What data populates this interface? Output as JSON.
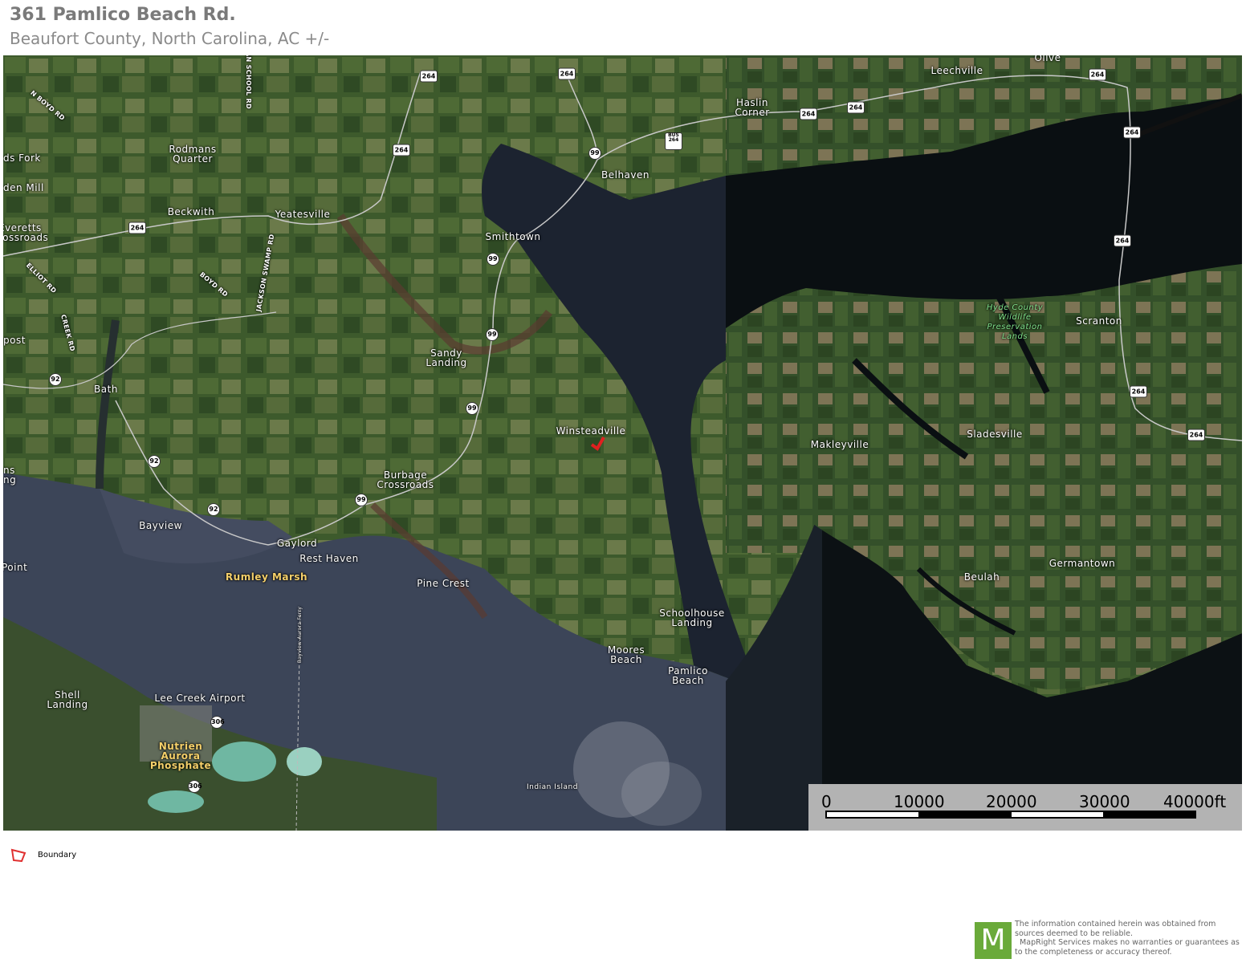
{
  "header": {
    "title": "361 Pamlico Beach Rd.",
    "subtitle": "Beaufort County, North Carolina,  AC +/-"
  },
  "map": {
    "places": [
      {
        "name": "Olive",
        "type": "town"
      },
      {
        "name": "Leechville",
        "type": "town"
      },
      {
        "name": "Haslin Corner",
        "type": "town"
      },
      {
        "name": "Belhaven",
        "type": "town"
      },
      {
        "name": "Rodmans Quarter",
        "type": "town"
      },
      {
        "name": "Beckwith",
        "type": "town"
      },
      {
        "name": "Yeatesville",
        "type": "town"
      },
      {
        "name": "Smithtown",
        "type": "town"
      },
      {
        "name": "Sandy Landing",
        "type": "town"
      },
      {
        "name": "Bath",
        "type": "town"
      },
      {
        "name": "Winsteadville",
        "type": "town"
      },
      {
        "name": "Burbage Crossroads",
        "type": "town"
      },
      {
        "name": "Bayview",
        "type": "town"
      },
      {
        "name": "Gaylord",
        "type": "town"
      },
      {
        "name": "Rest Haven",
        "type": "town"
      },
      {
        "name": "Pine Crest",
        "type": "town"
      },
      {
        "name": "Schoolhouse Landing",
        "type": "town"
      },
      {
        "name": "Moores Beach",
        "type": "town"
      },
      {
        "name": "Pamlico Beach",
        "type": "town"
      },
      {
        "name": "Makleyville",
        "type": "town"
      },
      {
        "name": "Sladesville",
        "type": "town"
      },
      {
        "name": "Scranton",
        "type": "town"
      },
      {
        "name": "Germantown",
        "type": "town"
      },
      {
        "name": "Beulah",
        "type": "town"
      },
      {
        "name": "Shell Landing",
        "type": "town"
      },
      {
        "name": "Indian Island",
        "type": "island"
      },
      {
        "name": "Lee Creek Airport",
        "type": "airport"
      },
      {
        "name": "Rumley Marsh",
        "type": "poi"
      },
      {
        "name": "Nutrien Aurora Phosphate",
        "type": "poi"
      },
      {
        "name": "Hyde County Wildlife Preservation Lands",
        "type": "park"
      },
      {
        "name": "ds Fork",
        "type": "edge"
      },
      {
        "name": "den Mill",
        "type": "edge"
      },
      {
        "name": "Everetts rossroads",
        "type": "edge"
      },
      {
        "name": "post",
        "type": "edge"
      },
      {
        "name": "ns ng",
        "type": "edge"
      },
      {
        "name": "Point",
        "type": "edge"
      }
    ],
    "roads": [
      "N BOYD RD",
      "AN SCHOOL RD",
      "JACKSON SWAMP RD",
      "BOYD RD",
      "ELLIOT RD",
      "CREEK RD",
      "Bayview-Aurora Ferry"
    ],
    "shields": [
      "264",
      "264",
      "264",
      "264",
      "264",
      "264",
      "264",
      "264",
      "264",
      "264",
      "99",
      "99",
      "99",
      "99",
      "99",
      "92",
      "92",
      "92",
      "306",
      "306",
      "BUS 264"
    ],
    "subject_marker_color": "#e02020"
  },
  "scale": {
    "labels": [
      "0",
      "10000",
      "20000",
      "30000",
      "40000ft"
    ]
  },
  "legend": {
    "label": "Boundary",
    "color": "#e03030"
  },
  "footer": {
    "logo_letter": "M",
    "disclaimer": "The information contained herein was obtained from sources deemed to be reliable.\n  MapRight Services makes no warranties or guarantees as to the completeness or accuracy thereof."
  }
}
